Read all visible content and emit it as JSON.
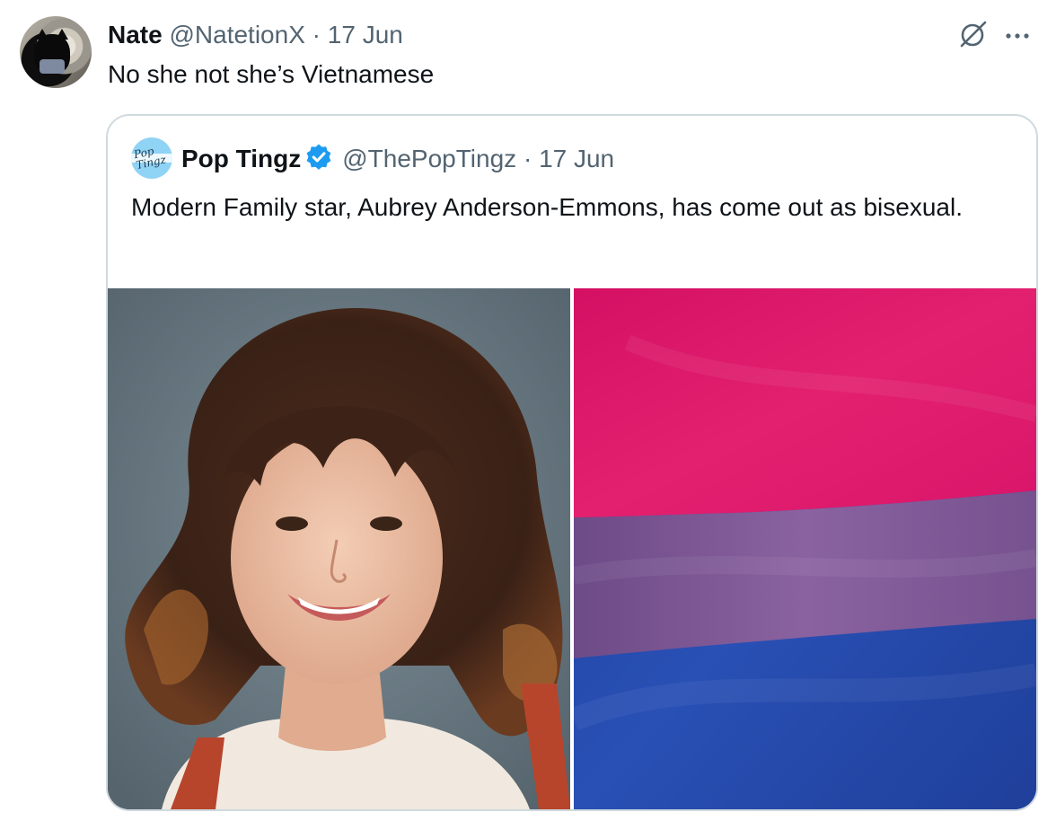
{
  "tweet": {
    "author_name": "Nate",
    "author_handle": "@NatetionX",
    "separator": "·",
    "date": "17 Jun",
    "text": "No she not she’s Vietnamese",
    "more_label": "···"
  },
  "quote": {
    "author_name": "Pop Tingz",
    "author_handle": "@ThePopTingz",
    "separator": "·",
    "date": "17 Jun",
    "avatar_text": "Pop Tingz",
    "text": "Modern Family star, Aubrey Anderson-Emmons, has come out as bisexual.",
    "media": [
      {
        "kind": "photo",
        "subject": "portrait"
      },
      {
        "kind": "photo",
        "subject": "bisexual-pride-flag",
        "colors": [
          "#d6156d",
          "#7b5594",
          "#1f41a8"
        ]
      }
    ]
  },
  "colors": {
    "text_primary": "#0f1419",
    "text_secondary": "#536471",
    "border": "#cfd9de",
    "verified": "#1d9bf0"
  },
  "icons": [
    "grok-icon",
    "more-icon",
    "verified-badge-icon"
  ]
}
